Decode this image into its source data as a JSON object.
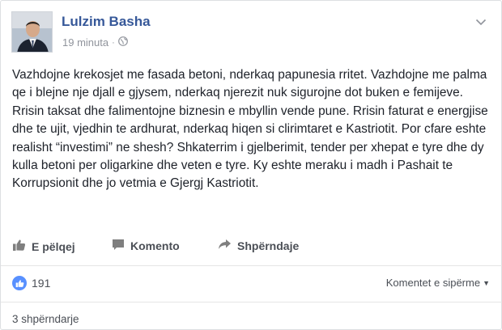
{
  "post": {
    "author": "Lulzim Basha",
    "time": "19 minuta",
    "separator": "·",
    "privacy_icon": "globe-icon",
    "text": "Vazhdojne krekosjet me fasada betoni, nderkaq papunesia rritet. Vazhdojne me palma qe i blejne nje djall e gjysem, nderkaq njerezit nuk sigurojne dot buken e femijeve. Rrisin taksat dhe falimentojne biznesin e mbyllin vende pune. Rrisin faturat e energjise dhe te ujit, vjedhin te ardhurat, nderkaq hiqen si clirimtaret e Kastriotit. Por cfare eshte realisht “investimi” ne shesh? Shkaterrim i gjelberimit, tender per xhepat e tyre dhe dy kulla betoni per oligarkine dhe veten e tyre. Ky eshte meraku i madh i Pashait te Korrupsionit dhe jo vetmia e Gjergj Kastriotit."
  },
  "actions": {
    "like": "E pëlqej",
    "comment": "Komento",
    "share": "Shpërndaje"
  },
  "stats": {
    "likes": "191",
    "sort_label": "Komentet e sipërme",
    "shares": "3 shpërndarje"
  },
  "colors": {
    "author": "#365899",
    "like_badge": "#5890ff",
    "text": "#1d2129",
    "muted": "#90949c"
  }
}
